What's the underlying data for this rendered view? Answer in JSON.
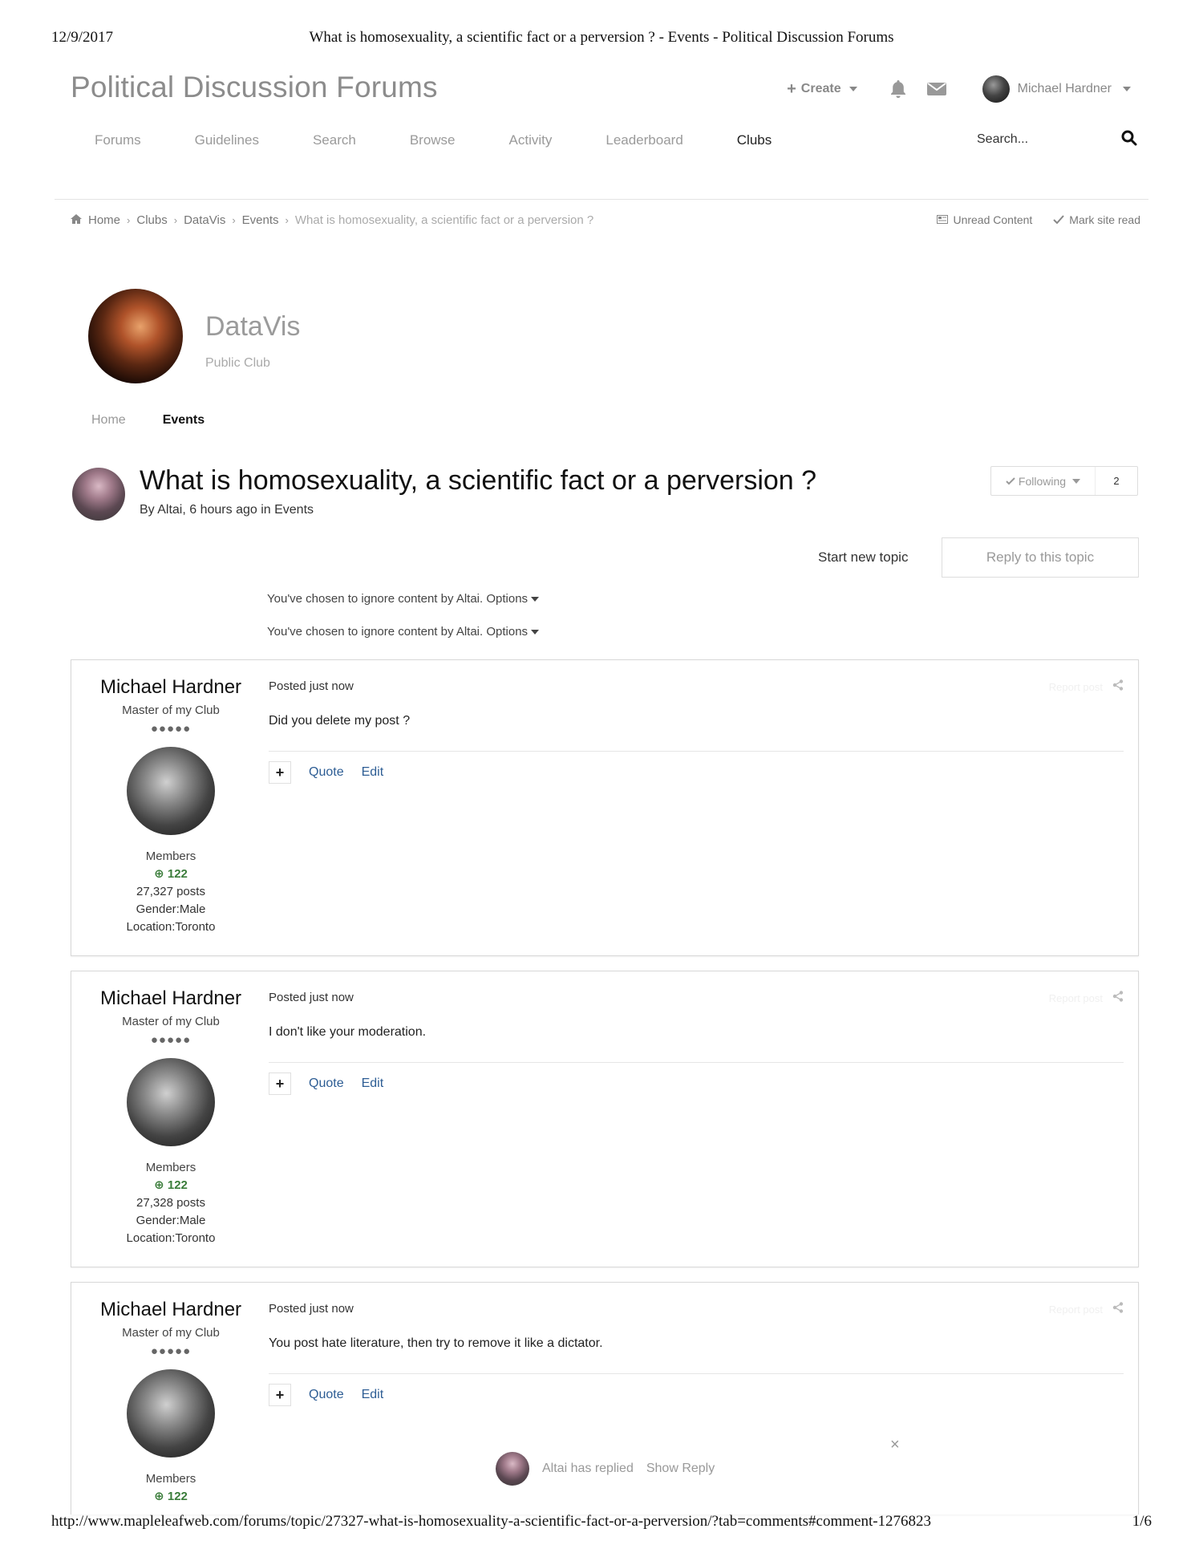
{
  "print": {
    "date": "12/9/2017",
    "title": "What is homosexuality, a scientific fact or a perversion ? - Events - Political Discussion Forums",
    "url": "http://www.mapleleafweb.com/forums/topic/27327-what-is-homosexuality-a-scientific-fact-or-a-perversion/?tab=comments#comment-1276823",
    "page": "1/6"
  },
  "header": {
    "site_title": "Political Discussion Forums",
    "create_label": "Create",
    "user_name": "Michael Hardner"
  },
  "nav": {
    "items": [
      "Forums",
      "Guidelines",
      "Search",
      "Browse",
      "Activity",
      "Leaderboard",
      "Clubs"
    ],
    "search_placeholder": "Search..."
  },
  "breadcrumb": {
    "items": [
      "Home",
      "Clubs",
      "DataVis",
      "Events"
    ],
    "current": "What is homosexuality, a scientific fact or a perversion ?",
    "unread": "Unread Content",
    "mark_read": "Mark site read"
  },
  "club": {
    "name": "DataVis",
    "type": "Public Club",
    "tabs": [
      "Home",
      "Events"
    ]
  },
  "topic": {
    "title": "What is homosexuality, a scientific fact or a perversion ?",
    "meta": "By Altai, 6 hours ago in Events",
    "following_label": "Following",
    "following_count": "2",
    "start_new": "Start new topic",
    "reply": "Reply to this topic"
  },
  "ignore_notice": {
    "text": "You've chosen to ignore content by Altai.",
    "options": "Options"
  },
  "posts": [
    {
      "author": "Michael Hardner",
      "rank": "Master of my Club",
      "pips": "●●●●●",
      "group": "Members",
      "reputation": "122",
      "posts": "27,327 posts",
      "gender": "Gender:Male",
      "location": "Location:Toronto",
      "date": "Posted just now",
      "content": "Did you delete my post ?",
      "report": "Report post",
      "quote": "Quote",
      "edit": "Edit"
    },
    {
      "author": "Michael Hardner",
      "rank": "Master of my Club",
      "pips": "●●●●●",
      "group": "Members",
      "reputation": "122",
      "posts": "27,328 posts",
      "gender": "Gender:Male",
      "location": "Location:Toronto",
      "date": "Posted just now",
      "content": "I don't like your moderation.",
      "report": "Report post",
      "quote": "Quote",
      "edit": "Edit"
    },
    {
      "author": "Michael Hardner",
      "rank": "Master of my Club",
      "pips": "●●●●●",
      "group": "Members",
      "reputation": "122",
      "date": "Posted just now",
      "content": "You post hate literature, then try to remove it like a dictator.",
      "report": "Report post",
      "quote": "Quote",
      "edit": "Edit"
    }
  ],
  "reply_notice": {
    "text": "Altai has replied",
    "action": "Show Reply"
  },
  "icons": {
    "bell": "bell-icon",
    "mail": "envelope-icon",
    "search": "search-icon",
    "home": "home-icon",
    "unread": "newspaper-icon",
    "check": "check-icon",
    "share": "share-icon",
    "close": "close-icon"
  },
  "colors": {
    "reputation": "#3b7d3b",
    "link": "#2d5d94"
  }
}
